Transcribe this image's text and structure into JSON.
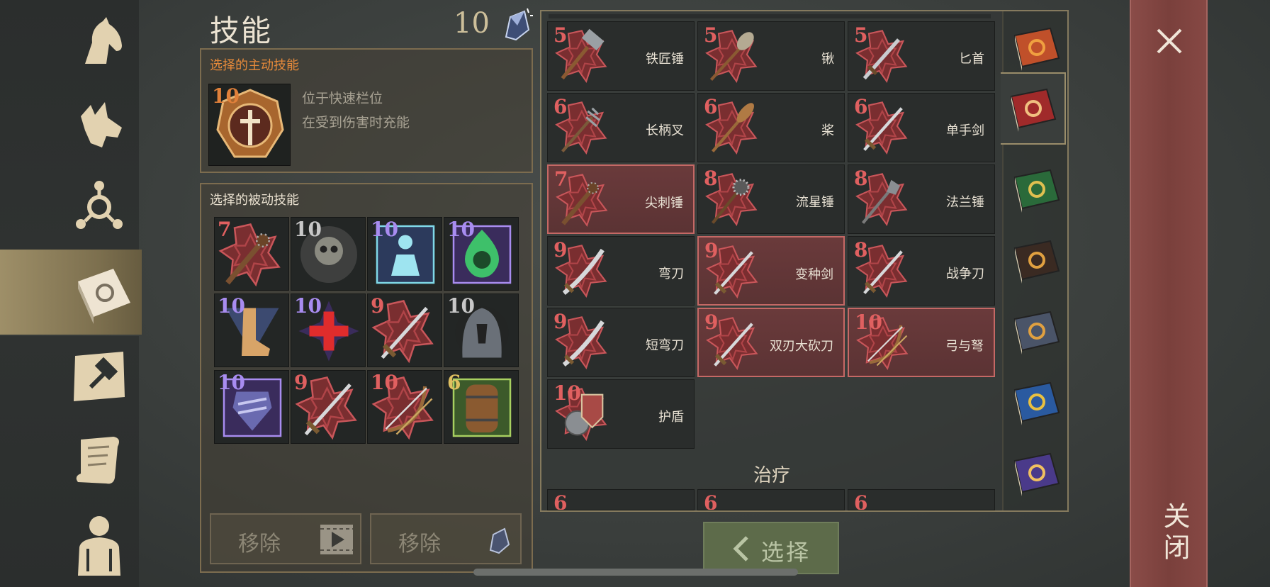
{
  "header": {
    "title": "技能",
    "skill_points": "10"
  },
  "active_skill": {
    "heading": "选择的主动技能",
    "level": "10",
    "desc_line1": "位于快速栏位",
    "desc_line2": "在受到伤害时充能"
  },
  "passive_skills": {
    "heading": "选择的被动技能",
    "slots": [
      {
        "level": "7",
        "icon": "mace-icon",
        "lvl_color": "#e06060"
      },
      {
        "level": "10",
        "icon": "skull-helmet-icon",
        "lvl_color": "#c8c8c8"
      },
      {
        "level": "10",
        "icon": "glowing-figure-icon",
        "lvl_color": "#a88cf0"
      },
      {
        "level": "10",
        "icon": "poison-skull-icon",
        "lvl_color": "#a88cf0"
      },
      {
        "level": "10",
        "icon": "boot-icon",
        "lvl_color": "#a88cf0"
      },
      {
        "level": "10",
        "icon": "red-cross-icon",
        "lvl_color": "#a88cf0"
      },
      {
        "level": "9",
        "icon": "sword-icon",
        "lvl_color": "#e06060"
      },
      {
        "level": "10",
        "icon": "hood-icon",
        "lvl_color": "#c8c8c8"
      },
      {
        "level": "10",
        "icon": "armor-icon",
        "lvl_color": "#a88cf0"
      },
      {
        "level": "9",
        "icon": "sword-icon",
        "lvl_color": "#e06060"
      },
      {
        "level": "10",
        "icon": "bow-icon",
        "lvl_color": "#e06060"
      },
      {
        "level": "6",
        "icon": "barrel-icon",
        "lvl_color": "#e0c060"
      }
    ]
  },
  "buttons": {
    "remove_video": "移除",
    "remove_crystal": "移除",
    "select": "选择",
    "close": "关闭"
  },
  "weapon_skills": [
    {
      "level": "5",
      "label": "铁匠锤",
      "icon": "hammer-icon",
      "selected": false
    },
    {
      "level": "5",
      "label": "锹",
      "icon": "shovel-icon",
      "selected": false
    },
    {
      "level": "5",
      "label": "匕首",
      "icon": "dagger-icon",
      "selected": false
    },
    {
      "level": "6",
      "label": "长柄叉",
      "icon": "pitchfork-icon",
      "selected": false
    },
    {
      "level": "6",
      "label": "桨",
      "icon": "oar-icon",
      "selected": false
    },
    {
      "level": "6",
      "label": "单手剑",
      "icon": "sword-icon",
      "selected": false
    },
    {
      "level": "7",
      "label": "尖刺锤",
      "icon": "spiked-mace-icon",
      "selected": true
    },
    {
      "level": "8",
      "label": "流星锤",
      "icon": "morningstar-icon",
      "selected": false
    },
    {
      "level": "8",
      "label": "法兰锤",
      "icon": "flanged-mace-icon",
      "selected": false
    },
    {
      "level": "9",
      "label": "弯刀",
      "icon": "sabre-icon",
      "selected": false
    },
    {
      "level": "9",
      "label": "变种剑",
      "icon": "longsword-icon",
      "selected": true
    },
    {
      "level": "8",
      "label": "战争刀",
      "icon": "war-blade-icon",
      "selected": false
    },
    {
      "level": "9",
      "label": "短弯刀",
      "icon": "scimitar-icon",
      "selected": false
    },
    {
      "level": "9",
      "label": "双刃大砍刀",
      "icon": "greatsword-icon",
      "selected": true
    },
    {
      "level": "10",
      "label": "弓与弩",
      "icon": "bow-icon",
      "selected": true
    },
    {
      "level": "10",
      "label": "护盾",
      "icon": "shield-icon",
      "selected": false
    }
  ],
  "section_heal": "治疗",
  "heal_preview_levels": [
    "6",
    "6",
    "6"
  ],
  "colors": {
    "level_red": "#e06060",
    "level_purple": "#a88cf0",
    "selected_border": "#c56865"
  }
}
